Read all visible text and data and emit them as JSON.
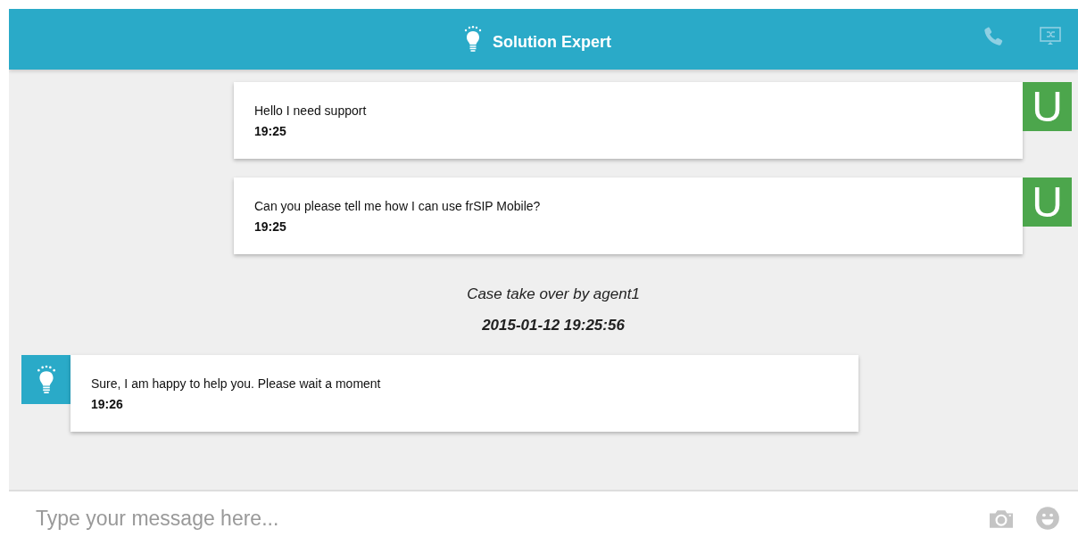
{
  "header": {
    "title": "Solution Expert"
  },
  "messages": [
    {
      "kind": "user",
      "avatar": "U",
      "text": "Hello I need support",
      "time": "19:25"
    },
    {
      "kind": "user",
      "avatar": "U",
      "text": "Can you please tell me how I can use frSIP Mobile?",
      "time": "19:25"
    },
    {
      "kind": "event",
      "text": "Case take over by agent1",
      "time": "2015-01-12 19:25:56"
    },
    {
      "kind": "agent",
      "text": "Sure, I am happy to help you. Please wait a moment",
      "time": "19:26"
    }
  ],
  "composer": {
    "placeholder": "Type your message here..."
  }
}
